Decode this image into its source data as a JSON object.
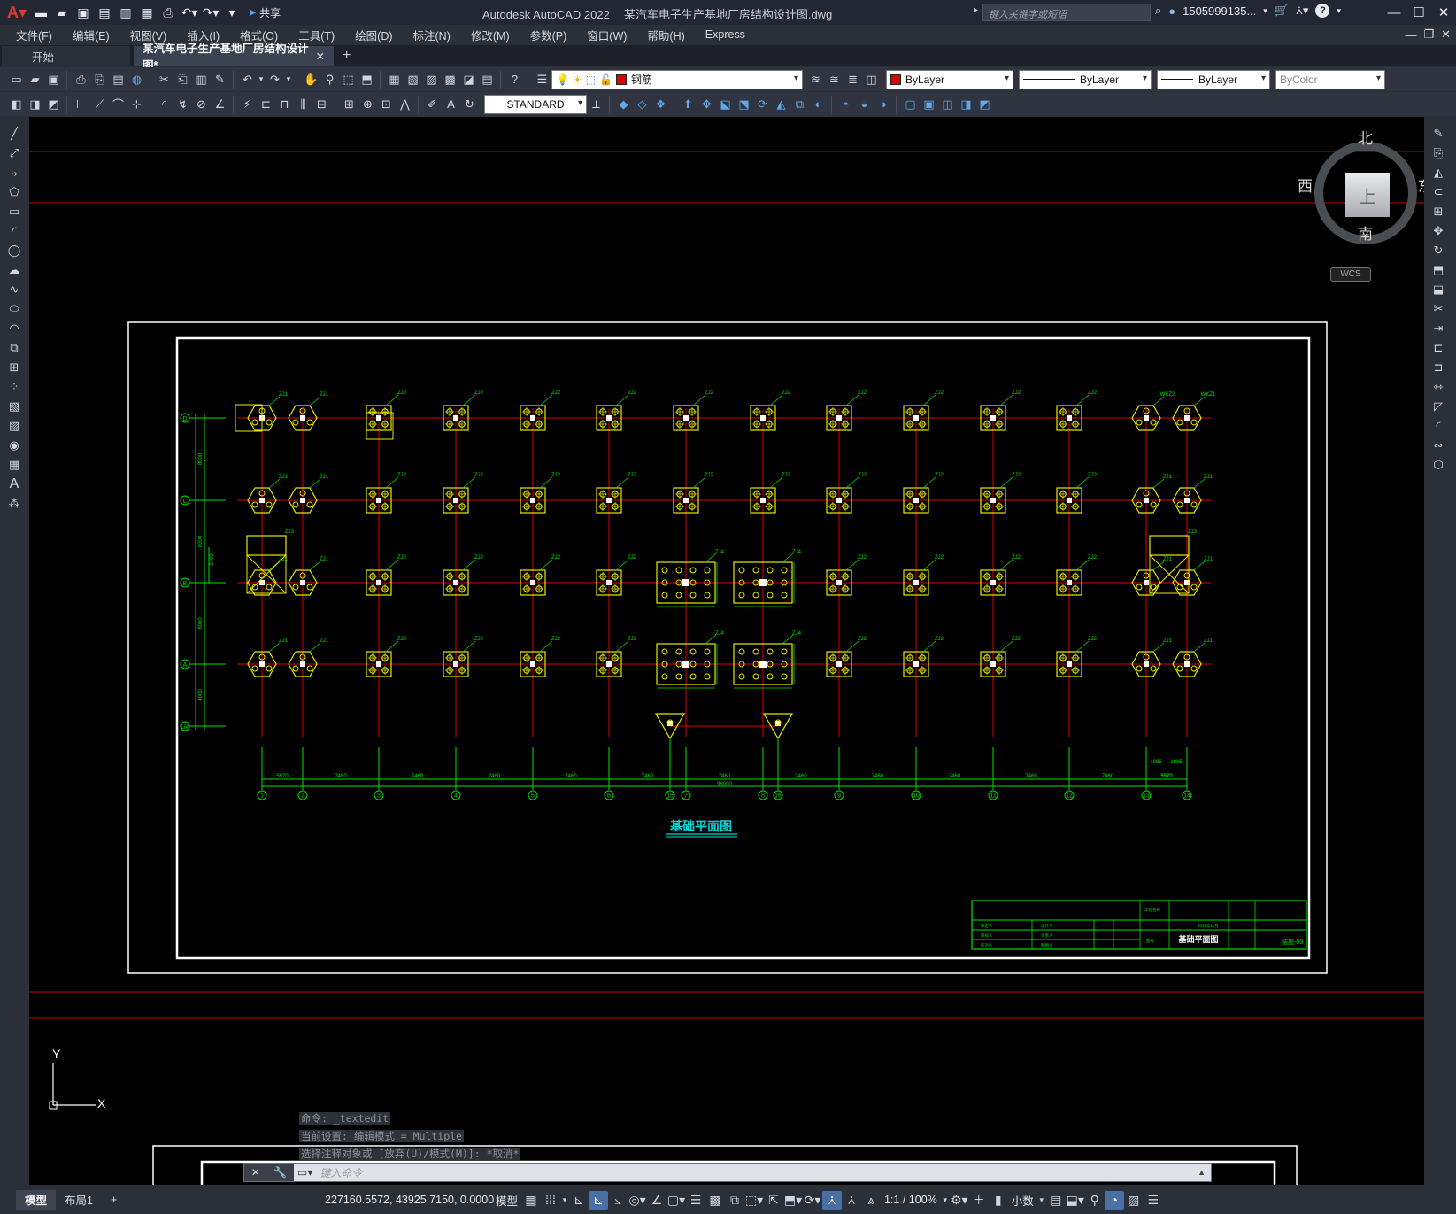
{
  "app": {
    "window_title": "Autodesk AutoCAD 2022",
    "file_title": "某汽车电子生产基地厂房结构设计图.dwg"
  },
  "quick_access": {
    "share_label": "共享"
  },
  "search": {
    "placeholder": "键入关键字或短语"
  },
  "user": {
    "name": "1505999135...",
    "help_label": "?"
  },
  "menu": [
    "文件(F)",
    "编辑(E)",
    "视图(V)",
    "插入(I)",
    "格式(O)",
    "工具(T)",
    "绘图(D)",
    "标注(N)",
    "修改(M)",
    "参数(P)",
    "窗口(W)",
    "帮助(H)",
    "Express"
  ],
  "tabs": {
    "start": "开始",
    "active": "某汽车电子生产基地厂房结构设计图*",
    "close": "✕",
    "new": "+"
  },
  "layers": {
    "current_layer": "钢筋",
    "color": "ByLayer",
    "linetype": "ByLayer",
    "lineweight": "ByLayer",
    "plotstyle": "ByColor",
    "layer_color": "#d90000"
  },
  "styles": {
    "text_style": "STANDARD"
  },
  "viewcube": {
    "north": "北",
    "south": "南",
    "west": "西",
    "east": "东",
    "face": "上",
    "wcs": "WCS"
  },
  "drawing": {
    "title": "基础平面图",
    "total_length": "98000",
    "x_axes": [
      "1",
      "2",
      "3",
      "4",
      "5",
      "6",
      "15",
      "7",
      "8",
      "16",
      "9",
      "10",
      "11",
      "12",
      "13",
      "14"
    ],
    "y_axes": [
      "D",
      "C",
      "B",
      "A",
      "1/A"
    ],
    "x_dims": [
      "5970",
      "7460",
      "7460",
      "7460",
      "7460",
      "7460",
      "7460",
      "7460",
      "7460",
      "7460",
      "7460",
      "7460",
      "5970"
    ],
    "y_dims": [
      "8000",
      "8000",
      "8000",
      "4000"
    ],
    "footing_labels": [
      "ZJ1",
      "ZJ2",
      "ZJ3",
      "ZJ4",
      "WKZ1",
      "WKZ2",
      "ZJ5"
    ],
    "dim_2400": "2400",
    "dim_1985": "1985",
    "dim_3970": "3970",
    "title_block": {
      "drawing_name": "基础平面图",
      "drawing_no": "结施-03",
      "row_labels": [
        "审定人",
        "审核人",
        "校对人",
        "设计人",
        "负责人",
        "制图人"
      ],
      "project": "工程名称",
      "date": "2018年11月",
      "sheet": "图号"
    }
  },
  "colors": {
    "footing": "#e8e800",
    "axis": "#e00000",
    "dim": "#00e000",
    "title": "#00d8d8",
    "frame": "#ffffff"
  },
  "command": {
    "history": [
      "命令: _textedit",
      "当前设置: 编辑模式 = Multiple",
      "选择注释对象或 [放弃(U)/模式(M)]: *取消*"
    ],
    "placeholder": "键入命令"
  },
  "ucs": {
    "x": "X",
    "y": "Y"
  },
  "status": {
    "layout_tabs": [
      "模型",
      "布局1"
    ],
    "add_layout": "+",
    "coords": "227160.5572, 43925.7150, 0.0000",
    "model_label": "模型",
    "scale": "1:1 / 100%",
    "units": "小数"
  }
}
